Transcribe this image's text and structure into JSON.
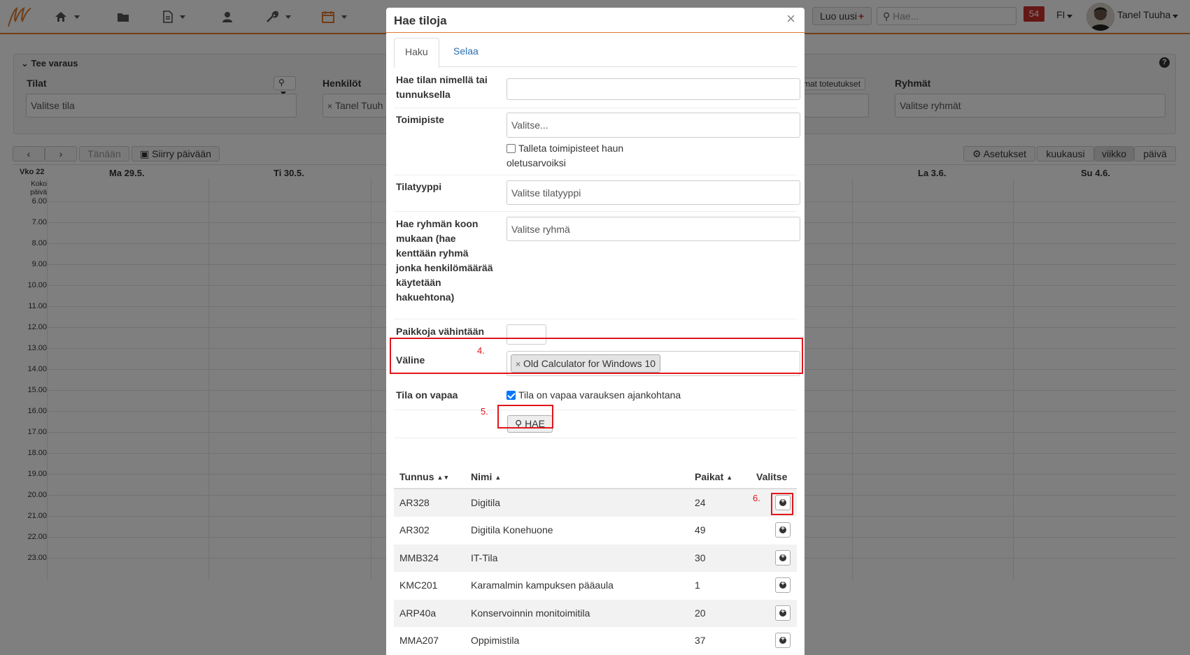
{
  "navbar": {
    "create_new": "Luo uusi",
    "search_placeholder": "Hae...",
    "notifications": "54",
    "language": "FI",
    "user_name": "Tanel Tuuha"
  },
  "background": {
    "panel_title": "Tee varaus",
    "spaces_label": "Tilat",
    "spaces_placeholder": "Valitse tila",
    "persons_label": "Henkilöt",
    "persons_tag": "Tanel Tuuh",
    "implementations_btn": "mat toteutukset",
    "groups_label": "Ryhmät",
    "groups_placeholder": "Valitse ryhmät",
    "today_btn": "Tänään",
    "goto_day_btn": "Siirry päivään",
    "settings_btn": "Asetukset",
    "views": [
      "kuukausi",
      "viikko",
      "päivä"
    ],
    "week_label": "Vko 22",
    "all_day": "Koko päivä",
    "days": [
      "Ma 29.5.",
      "Ti 30.5.",
      "La 3.6.",
      "Su 4.6."
    ],
    "hours": [
      "6.00",
      "7.00",
      "8.00",
      "9.00",
      "10.00",
      "11.00",
      "12.00",
      "13.00",
      "14.00",
      "15.00",
      "16.00",
      "17.00",
      "18.00",
      "19.00",
      "20.00",
      "21.00",
      "22.00",
      "23.00"
    ]
  },
  "modal": {
    "title": "Hae tiloja",
    "close": "×",
    "tabs": [
      "Haku",
      "Selaa"
    ],
    "fields": {
      "name_label": "Hae tilan nimellä tai tunnuksella",
      "name_value": "",
      "office_label": "Toimipiste",
      "office_placeholder": "Valitse...",
      "office_save_label": "Talleta toimipisteet haun oletusarvoiksi",
      "type_label": "Tilatyyppi",
      "type_placeholder": "Valitse tilatyyppi",
      "group_size_label": "Hae ryhmän koon mukaan (hae kenttään ryhmä jonka henkilömäärää käytetään hakuehtona)",
      "group_size_placeholder": "Valitse ryhmä",
      "min_seats_label": "Paikkoja vähintään",
      "min_seats_value": "",
      "equipment_label": "Väline",
      "equipment_tag": "Old Calculator for Windows 10",
      "free_label": "Tila on vapaa",
      "free_checkbox_label": "Tila on vapaa varauksen ajankohtana",
      "search_button": "HAE"
    },
    "annotations": [
      "4.",
      "5.",
      "6."
    ],
    "table": {
      "headers": [
        "Tunnus",
        "Nimi",
        "Paikat",
        "Valitse"
      ],
      "rows": [
        {
          "code": "AR328",
          "name": "Digitila",
          "seats": "24"
        },
        {
          "code": "AR302",
          "name": "Digitila Konehuone",
          "seats": "49"
        },
        {
          "code": "MMB324",
          "name": "IT-Tila",
          "seats": "30"
        },
        {
          "code": "KMC201",
          "name": "Karamalmin kampuksen pääaula",
          "seats": "1"
        },
        {
          "code": "ARP40a",
          "name": "Konservoinnin monitoimitila",
          "seats": "20"
        },
        {
          "code": "MMA207",
          "name": "Oppimistila",
          "seats": "37"
        }
      ]
    }
  }
}
